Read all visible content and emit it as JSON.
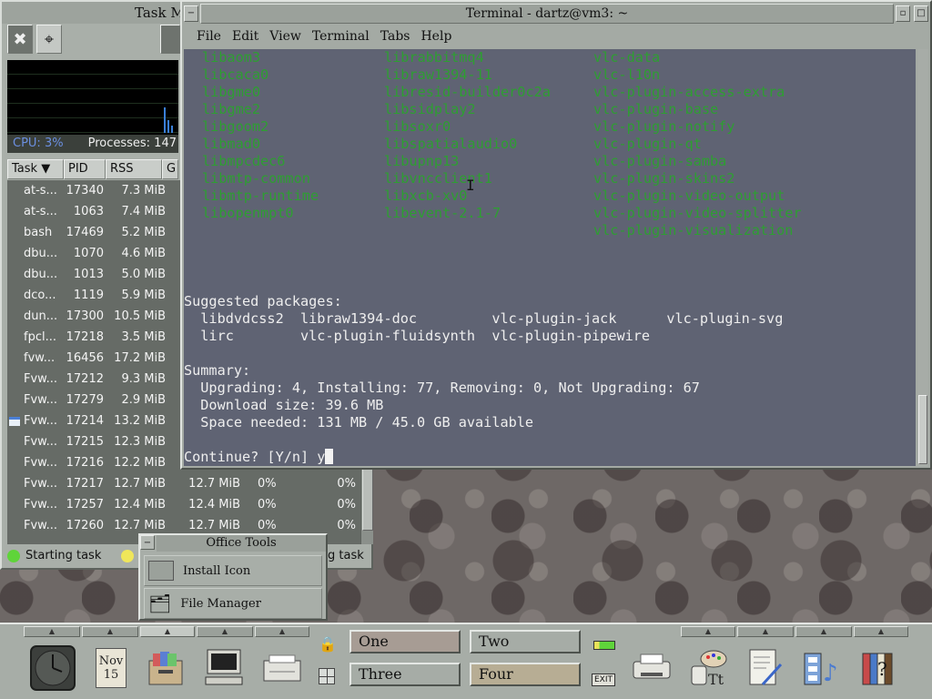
{
  "taskmanager": {
    "title": "Task M",
    "processes_label": "Processes: 147",
    "cpu_label": "CPU: 3%",
    "columns": [
      "Task",
      "PID",
      "RSS",
      "G"
    ],
    "rows": [
      {
        "task": "at-s...",
        "pid": "17340",
        "rss": "7.3 MiB"
      },
      {
        "task": "at-s...",
        "pid": "1063",
        "rss": "7.4 MiB"
      },
      {
        "task": "bash",
        "pid": "17469",
        "rss": "5.2 MiB"
      },
      {
        "task": "dbu...",
        "pid": "1070",
        "rss": "4.6 MiB"
      },
      {
        "task": "dbu...",
        "pid": "1013",
        "rss": "5.0 MiB"
      },
      {
        "task": "dco...",
        "pid": "1119",
        "rss": "5.9 MiB"
      },
      {
        "task": "dun...",
        "pid": "17300",
        "rss": "10.5 MiB"
      },
      {
        "task": "fpcl...",
        "pid": "17218",
        "rss": "3.5 MiB"
      },
      {
        "task": "fvw...",
        "pid": "16456",
        "rss": "17.2 MiB"
      },
      {
        "task": "Fvw...",
        "pid": "17212",
        "rss": "9.3 MiB"
      },
      {
        "task": "Fvw...",
        "pid": "17279",
        "rss": "2.9 MiB"
      },
      {
        "task": "Fvw...",
        "pid": "17214",
        "rss": "13.2 MiB"
      },
      {
        "task": "Fvw...",
        "pid": "17215",
        "rss": "12.3 MiB"
      },
      {
        "task": "Fvw...",
        "pid": "17216",
        "rss": "12.2 MiB"
      },
      {
        "task": "Fvw...",
        "pid": "17217",
        "rss": "12.7 MiB",
        "rss2": "12.7 MiB",
        "cpu1": "0%",
        "cpu2": "0%"
      },
      {
        "task": "Fvw...",
        "pid": "17257",
        "rss": "12.4 MiB",
        "rss2": "12.4 MiB",
        "cpu1": "0%",
        "cpu2": "0%"
      },
      {
        "task": "Fvw...",
        "pid": "17260",
        "rss": "12.7 MiB",
        "rss2": "12.7 MiB",
        "cpu1": "0%",
        "cpu2": "0%"
      }
    ],
    "status_left": "Starting task",
    "status_right": "g task"
  },
  "terminal": {
    "title": "Terminal - dartz@vm3: ~",
    "menu": [
      "File",
      "Edit",
      "View",
      "Terminal",
      "Tabs",
      "Help"
    ],
    "packages_col1": [
      "libaom3",
      "libcaca0",
      "libgme0",
      "libgme2",
      "libgoom2",
      "libmad0",
      "libmpcdec6",
      "libmtp-common",
      "libmtp-runtime",
      "libopenmpt0"
    ],
    "packages_col2": [
      "librabbitmq4",
      "libraw1394-11",
      "libresid-builder0c2a",
      "libsidplay2",
      "libsoxr0",
      "libspatialaudio0",
      "libupnp13",
      "libvncclient1",
      "libxcb-xv0",
      "libevent-2.1-7"
    ],
    "packages_col3": [
      "vlc-data",
      "vlc-l10n",
      "vlc-plugin-access-extra",
      "vlc-plugin-base",
      "vlc-plugin-notify",
      "vlc-plugin-qt",
      "vlc-plugin-samba",
      "vlc-plugin-skins2",
      "vlc-plugin-video-output",
      "vlc-plugin-video-splitter",
      "vlc-plugin-visualization"
    ],
    "suggested_header": "Suggested packages:",
    "suggested_line1": "  libdvdcss2  libraw1394-doc         vlc-plugin-jack      vlc-plugin-svg",
    "suggested_line2": "  lirc        vlc-plugin-fluidsynth  vlc-plugin-pipewire",
    "summary_header": "Summary:",
    "summary_line1": "  Upgrading: 4, Installing: 77, Removing: 0, Not Upgrading: 67",
    "summary_line2": "  Download size: 39.6 MB",
    "summary_line3": "  Space needed: 131 MB / 45.0 GB available",
    "prompt": "Continue? [Y/n] y"
  },
  "office_tools": {
    "title": "Office Tools",
    "items": [
      "Install Icon",
      "File Manager"
    ]
  },
  "panel": {
    "calendar_month": "Nov",
    "calendar_day": "15",
    "pager": [
      "One",
      "Two",
      "Three",
      "Four"
    ],
    "exit_label": "EXIT"
  },
  "colors": {
    "terminal_bg": "#5f6373",
    "package_green": "#2e9e32",
    "status_green": "#5fd43a",
    "status_yellow": "#efe65a"
  }
}
